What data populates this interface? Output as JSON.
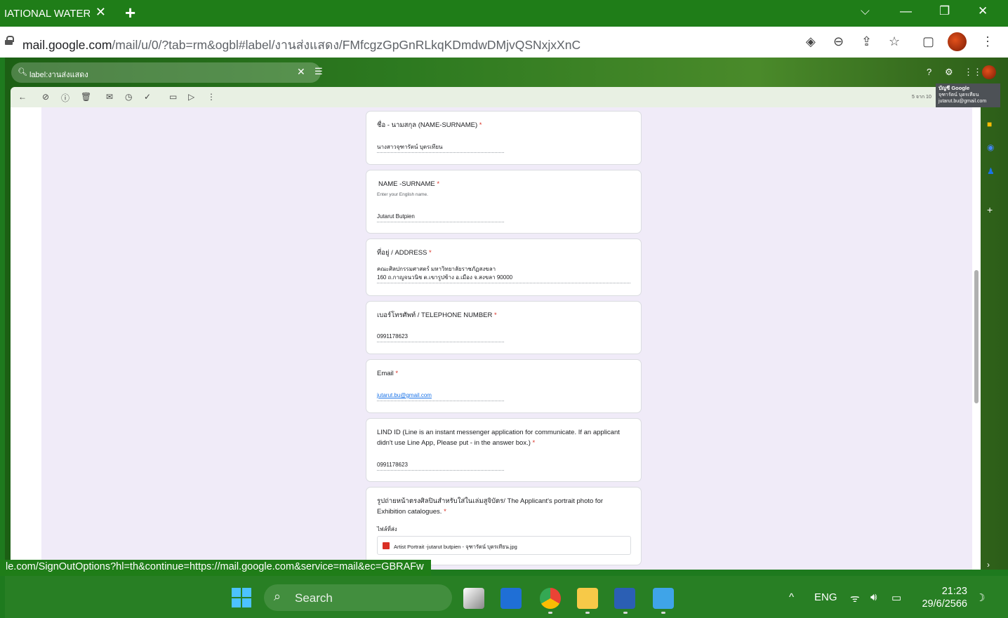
{
  "browser": {
    "tab_title": "IATIONAL WATERC",
    "url_host": "mail.google.com",
    "url_path": "/mail/u/0/?tab=rm&ogbl#label/งานส่งแสดง/FMfcgzGpGnRLkqKDmdwDMjvQSNxjxXnC",
    "status_url": "le.com/SignOutOptions?hl=th&continue=https://mail.google.com&service=mail&ec=GBRAFw"
  },
  "gmail": {
    "search_text": "label:งานส่งแสดง",
    "page_count": "5 จาก 10",
    "account_tooltip": {
      "title": "บัญชี Google",
      "name": "จุฑารัตน์ บุตรเทียน",
      "email": "jutarut.bu@gmail.com"
    }
  },
  "form": {
    "name_th": {
      "question": "ชื่อ - นามสกุล (NAME-SURNAME)",
      "required": "*",
      "answer": "นางสาวจุฑารัตน์ บุตรเทียน"
    },
    "name_en": {
      "question": "NAME -SURNAME",
      "required": "*",
      "hint": "Enter your English name.",
      "answer": "Jutarut Butpien"
    },
    "address": {
      "question": "ที่อยู่ / ADDRESS",
      "required": "*",
      "line1": "คณะศิลปกรรมศาสตร์ มหาวิทยาลัยราชภัฏสงขลา",
      "line2": "160 ถ.กาญจนวนิช ต.เขารูปช้าง อ.เมือง จ.สงขลา 90000"
    },
    "phone": {
      "question": "เบอร์โทรศัพท์ / TELEPHONE NUMBER",
      "required": "*",
      "answer": "0991178623"
    },
    "email": {
      "question": "Email",
      "required": "*",
      "answer": "jutarut.bu@gmail.com"
    },
    "line_id": {
      "question_line1": "LIND ID (Line is an instant messenger application for communicate. If an applicant",
      "question_line2": "didn't use Line App, Please put - in the answer box.)",
      "required": "*",
      "answer": "0991178623"
    },
    "portrait": {
      "question_line1": "รูปถ่ายหน้าตรงศิลปินสำหรับใส่ในเล่มสูจิบัตร/ The Applicant's portrait photo for",
      "question_line2": "Exhibition catalogues.",
      "required": "*",
      "files_label": "ไฟล์ที่ส่ง",
      "file_name": "Artist Portrait -jutarut butpien - จุฑารัตน์ บุตรเทียน.jpg"
    }
  },
  "taskbar": {
    "search_label": "Search",
    "language": "ENG",
    "time": "21:23",
    "date": "29/6/2566"
  }
}
